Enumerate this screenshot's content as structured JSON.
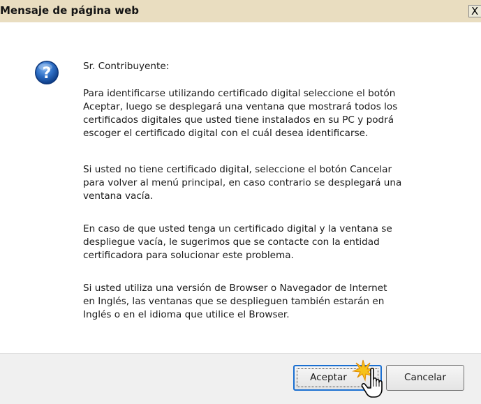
{
  "dialog": {
    "title": "Mensaje de página web",
    "close_glyph": "X",
    "icon": "question-icon",
    "greeting": "Sr. Contribuyente:",
    "paragraph1": [
      "Para identificarse utilizando certificado digital seleccione el botón",
      "Aceptar, luego se desplegará una ventana que mostrará todos los",
      "certificados digitales que usted tiene instalados en su PC y podrá",
      "escoger el certificado digital con el cuál desea identificarse."
    ],
    "paragraph2": [
      "Si usted no tiene certificado digital, seleccione el botón Cancelar",
      "para volver al menú principal, en caso contrario se desplegará una",
      "ventana vacía."
    ],
    "paragraph3": [
      "En caso de que usted tenga un certificado digital y la ventana se",
      "despliegue vacía, le sugerimos que se contacte con la entidad",
      "certificadora para solucionar este problema."
    ],
    "paragraph4": [
      "Si usted utiliza una versión de Browser o Navegador de Internet",
      "en Inglés, las ventanas que se desplieguen también estarán en",
      "Inglés o en el idioma que utilice el Browser."
    ]
  },
  "buttons": {
    "accept_label": "Aceptar",
    "cancel_label": "Cancelar"
  },
  "colors": {
    "titlebar": "#e9ddc0",
    "footer": "#f0f0f0",
    "icon_blue": "#1f5fb8",
    "focus_border": "#1a6fd1"
  }
}
